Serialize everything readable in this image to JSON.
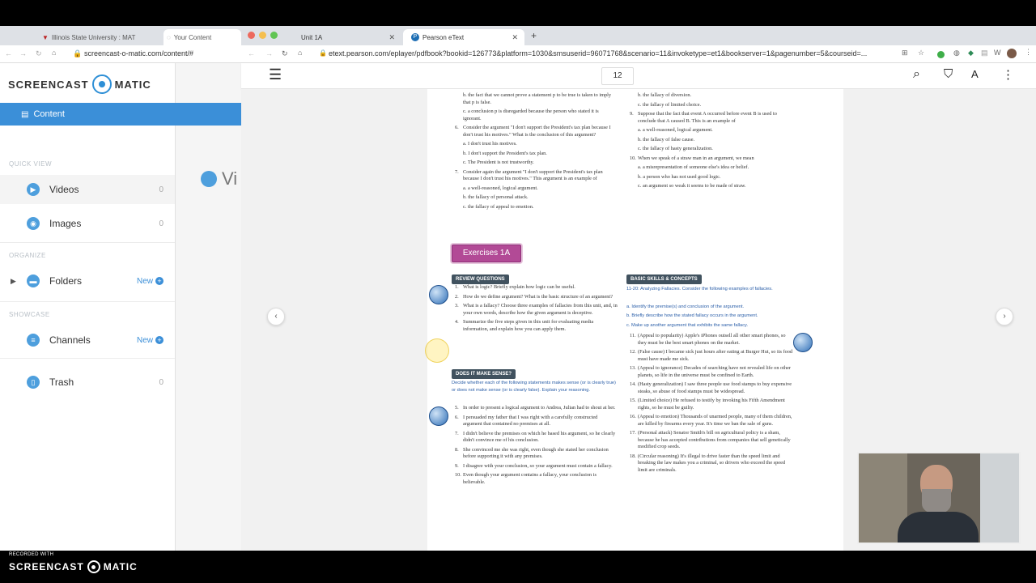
{
  "back_window": {
    "tabs": [
      {
        "title": "Illinois State University : MAT"
      },
      {
        "title": "Your Content"
      }
    ],
    "url": "screencast-o-matic.com/content/#",
    "logo": {
      "left": "SCREENCAST",
      "right": "MATIC"
    },
    "content_label": "Content",
    "sections": {
      "quick_view": "QUICK VIEW",
      "organize": "ORGANIZE",
      "showcase": "SHOWCASE"
    },
    "nav": {
      "videos": {
        "label": "Videos",
        "count": "0"
      },
      "images": {
        "label": "Images",
        "count": "0"
      },
      "folders": {
        "label": "Folders",
        "new": "New"
      },
      "channels": {
        "label": "Channels",
        "new": "New"
      },
      "trash": {
        "label": "Trash",
        "count": "0"
      }
    },
    "page_title": "Vi"
  },
  "front_window": {
    "tabs": [
      {
        "title": "Unit 1A"
      },
      {
        "title": "Pearson eText"
      }
    ],
    "url": "etext.pearson.com/eplayer/pdfbook?bookid=126773&platform=1030&smsuserid=96071768&scenario=11&invoketype=et1&bookserver=1&pagenumber=5&courseid=...",
    "page_number": "12",
    "pdf": {
      "left_top": {
        "b_prev": "b. the fact that we cannot prove a statement p to be true is taken to imply that p is false.",
        "c_prev": "c. a conclusion p is disregarded because the person who stated it is ignorant.",
        "q6": "Consider the argument \"I don't support the President's tax plan because I don't trust his motives.\" What is the conclusion of this argument?",
        "q6a": "a. I don't trust his motives.",
        "q6b": "b. I don't support the President's tax plan.",
        "q6c": "c. The President is not trustworthy.",
        "q7": "Consider again the argument \"I don't support the President's tax plan because I don't trust his motives.\" This argument is an example of",
        "q7a": "a. a well-reasoned, logical argument.",
        "q7b": "b. the fallacy of personal attack.",
        "q7c": "c. the fallacy of appeal to emotion."
      },
      "right_top": {
        "b_prev": "b. the fallacy of diversion.",
        "c_prev": "c. the fallacy of limited choice.",
        "q9": "Suppose that the fact that event A occurred before event B is used to conclude that A caused B. This is an example of",
        "q9a": "a. a well-reasoned, logical argument.",
        "q9b": "b. the fallacy of false cause.",
        "q9c": "c. the fallacy of hasty generalization.",
        "q10": "When we speak of a straw man in an argument, we mean",
        "q10a": "a. a misrepresentation of someone else's idea or belief.",
        "q10b": "b. a person who has not used good logic.",
        "q10c": "c. an argument so weak it seems to be made of straw."
      },
      "exercises_title": "Exercises 1A",
      "review_header": "REVIEW QUESTIONS",
      "review": [
        "What is logic? Briefly explain how logic can be useful.",
        "How do we define argument? What is the basic structure of an argument?",
        "What is a fallacy? Choose three examples of fallacies from this unit, and, in your own words, describe how the given argument is deceptive.",
        "Summarize the five steps given in this unit for evaluating media information, and explain how you can apply them."
      ],
      "sense_header": "DOES IT MAKE SENSE?",
      "sense_intro": "Decide whether each of the following statements makes sense (or is clearly true) or does not make sense (or is clearly false). Explain your reasoning.",
      "sense": [
        "In order to present a logical argument to Andrea, Julian had to shout at her.",
        "I persuaded my father that I was right with a carefully constructed argument that contained no premises at all.",
        "I didn't believe the premises on which he based his argument, so he clearly didn't convince me of his conclusion.",
        "She convinced me she was right, even though she stated her conclusion before supporting it with any premises.",
        "I disagree with your conclusion, so your argument must contain a fallacy.",
        "Even though your argument contains a fallacy, your conclusion is believable."
      ],
      "basic_header": "BASIC SKILLS & CONCEPTS",
      "basic_intro": "11-20: Analyzing Fallacies. Consider the following examples of fallacies.",
      "basic_steps": [
        "a. Identify the premise(s) and conclusion of the argument.",
        "b. Briefly describe how the stated fallacy occurs in the argument.",
        "c. Make up another argument that exhibits the same fallacy."
      ],
      "basic": [
        "(Appeal to popularity) Apple's iPhones outsell all other smart phones, so they must be the best smart phones on the market.",
        "(False cause) I became sick just hours after eating at Burger Hut, so its food must have made me sick.",
        "(Appeal to ignorance) Decades of searching have not revealed life on other planets, so life in the universe must be confined to Earth.",
        "(Hasty generalization) I saw three people use food stamps to buy expensive steaks, so abuse of food stamps must be widespread.",
        "(Limited choice) He refused to testify by invoking his Fifth Amendment rights, so he must be guilty.",
        "(Appeal to emotion) Thousands of unarmed people, many of them children, are killed by firearms every year. It's time we ban the sale of guns.",
        "(Personal attack) Senator Smith's bill on agricultural policy is a sham, because he has accepted contributions from companies that sell genetically modified crop seeds.",
        "(Circular reasoning) It's illegal to drive faster than the speed limit and breaking the law makes you a criminal, so drivers who exceed the speed limit are criminals."
      ]
    }
  },
  "watermark": {
    "recorded": "RECORDED WITH",
    "left": "SCREENCAST",
    "right": "MATIC"
  },
  "colors": {
    "accent": "#3b8fd8",
    "exercise": "#b24a96",
    "header_tag": "#41525f"
  }
}
